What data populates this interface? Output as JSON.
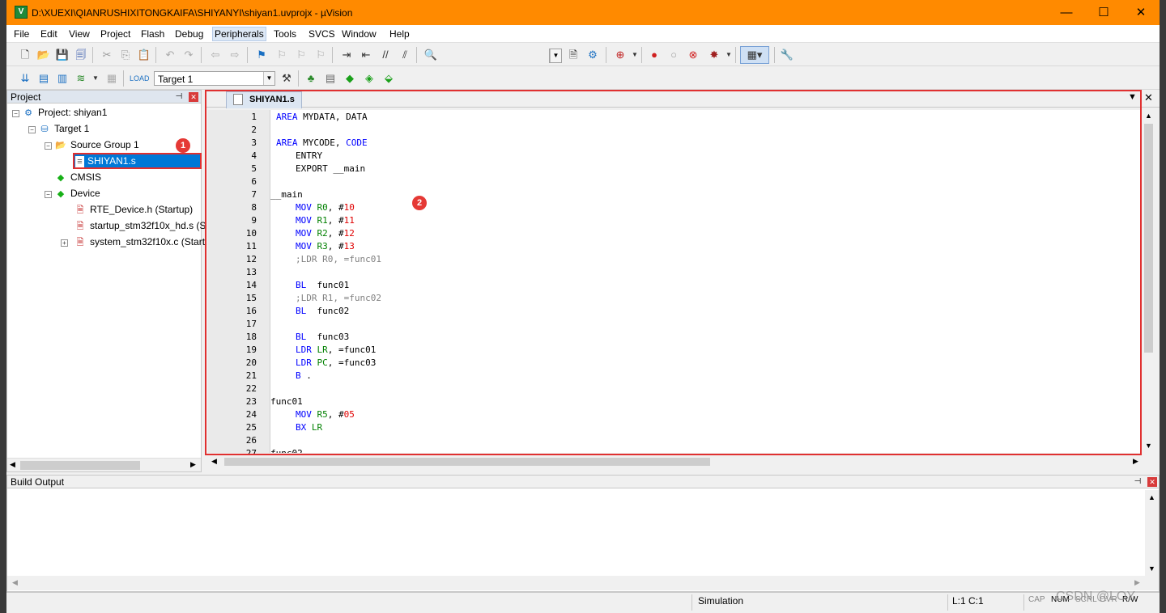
{
  "window": {
    "title": "D:\\XUEXI\\QIANRUSHIXITONGKAIFA\\SHIYANYI\\shiyan1.uvprojx - µVision",
    "minimize": "—",
    "maximize": "☐",
    "close": "✕"
  },
  "menu": [
    {
      "label": "File"
    },
    {
      "label": "Edit"
    },
    {
      "label": "View"
    },
    {
      "label": "Project"
    },
    {
      "label": "Flash"
    },
    {
      "label": "Debug"
    },
    {
      "label": "Peripherals"
    },
    {
      "label": "Tools"
    },
    {
      "label": "SVCS"
    },
    {
      "label": "Window"
    },
    {
      "label": "Help"
    }
  ],
  "toolbar2": {
    "target_select": "Target 1"
  },
  "project_panel": {
    "title": "Project",
    "tree": [
      {
        "label": "Project: shiyan1",
        "icon": "project-icon"
      },
      {
        "label": "Target 1",
        "icon": "target-icon"
      },
      {
        "label": "Source Group 1",
        "icon": "folder-icon"
      },
      {
        "label": "SHIYAN1.s",
        "icon": "asm-file-icon"
      },
      {
        "label": "CMSIS",
        "icon": "component-diamond-icon"
      },
      {
        "label": "Device",
        "icon": "component-diamond-icon"
      },
      {
        "label": "RTE_Device.h (Startup)",
        "icon": "locked-file-icon"
      },
      {
        "label": "startup_stm32f10x_hd.s (S",
        "icon": "locked-file-icon"
      },
      {
        "label": "system_stm32f10x.c (Start",
        "icon": "locked-file-icon"
      }
    ]
  },
  "editor": {
    "tab": "SHIYAN1.s",
    "lines": [
      {
        "n": "1"
      },
      {
        "n": "2"
      },
      {
        "n": "3"
      },
      {
        "n": "4"
      },
      {
        "n": "5"
      },
      {
        "n": "6"
      },
      {
        "n": "7"
      },
      {
        "n": "8"
      },
      {
        "n": "9"
      },
      {
        "n": "10"
      },
      {
        "n": "11"
      },
      {
        "n": "12"
      },
      {
        "n": "13"
      },
      {
        "n": "14"
      },
      {
        "n": "15"
      },
      {
        "n": "16"
      },
      {
        "n": "17"
      },
      {
        "n": "18"
      },
      {
        "n": "19"
      },
      {
        "n": "20"
      },
      {
        "n": "21"
      },
      {
        "n": "22"
      },
      {
        "n": "23"
      },
      {
        "n": "24"
      },
      {
        "n": "25"
      },
      {
        "n": "26"
      },
      {
        "n": "27"
      }
    ],
    "code": {
      "l1a": "AREA",
      "l1b": " MYDATA, DATA",
      "l3a": "AREA",
      "l3b": " MYCODE, ",
      "l3c": "CODE",
      "l4": "ENTRY",
      "l5": "EXPORT __main",
      "l7": "__main",
      "l8a": "MOV",
      "l8b": "R0",
      "l8c": ", #",
      "l8d": "10",
      "l9a": "MOV",
      "l9b": "R1",
      "l9c": ", #",
      "l9d": "11",
      "l10a": "MOV",
      "l10b": "R2",
      "l10c": ", #",
      "l10d": "12",
      "l11a": "MOV",
      "l11b": "R3",
      "l11c": ", #",
      "l11d": "13",
      "l12": ";LDR R0, =func01",
      "l14a": "BL",
      "l14b": "  func01",
      "l15": ";LDR R1, =func02",
      "l16a": "BL",
      "l16b": "  func02",
      "l18a": "BL",
      "l18b": "  func03",
      "l19a": "LDR",
      "l19b": "LR",
      "l19c": ", =func01",
      "l20a": "LDR",
      "l20b": "PC",
      "l20c": ", =func03",
      "l21a": "B",
      "l21b": " .",
      "l23": "func01",
      "l24a": "MOV",
      "l24b": "R5",
      "l24c": ", #",
      "l24d": "05",
      "l25a": "BX",
      "l25b": "LR",
      "l27": "func02"
    }
  },
  "annotations": {
    "badge1": "1",
    "badge2": "2"
  },
  "build_output": {
    "title": "Build Output"
  },
  "status": {
    "mode": "Simulation",
    "position": "L:1 C:1",
    "cap": "CAP",
    "num": "NUM",
    "scrl": "SCRL",
    "ovr": "OVR",
    "rw": "R/W",
    "watermark": "CSDN @LOY"
  }
}
